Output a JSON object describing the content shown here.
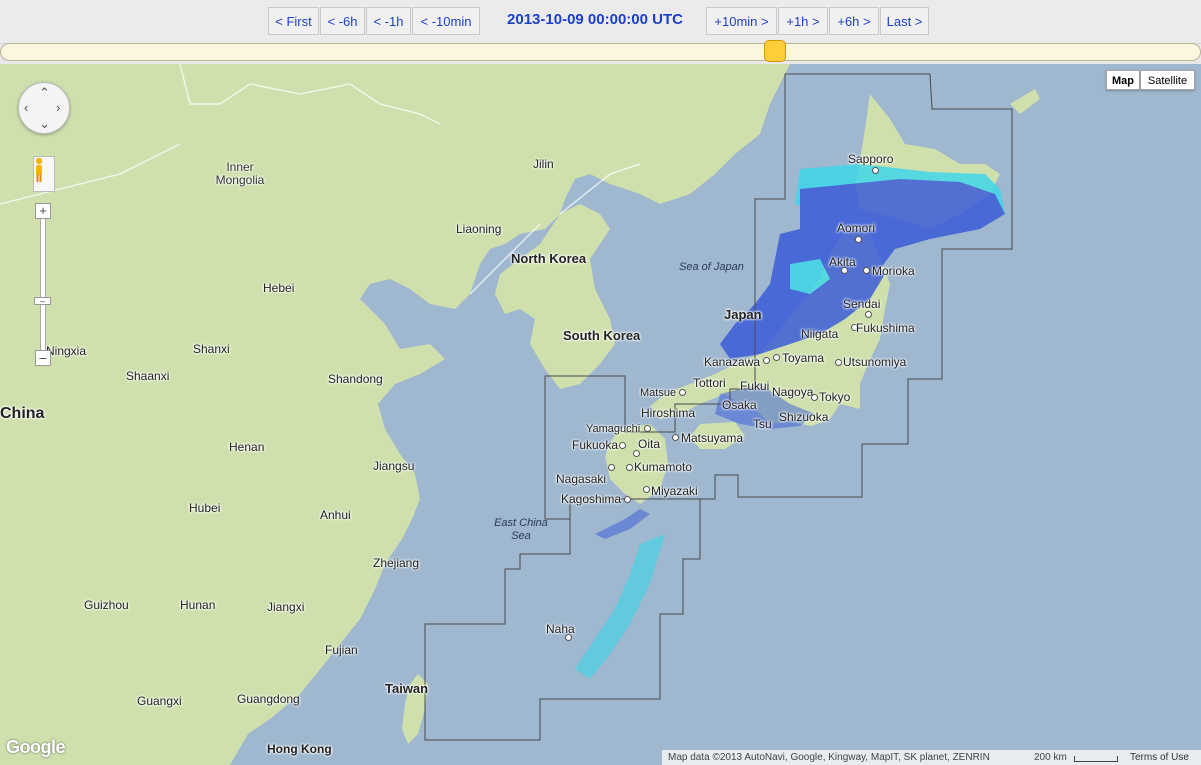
{
  "nav": {
    "first": "< First",
    "minus6h": "< -6h",
    "minus1h": "< -1h",
    "minus10min": "< -10min",
    "timestamp": "2013-10-09 00:00:00 UTC",
    "plus10min": "+10min >",
    "plus1h": "+1h >",
    "plus6h": "+6h >",
    "last": "Last >"
  },
  "map_type": {
    "map": "Map",
    "satellite": "Satellite",
    "selected": "Map"
  },
  "labels": {
    "inner_mongolia": "Inner Mongolia",
    "jilin": "Jilin",
    "liaoning": "Liaoning",
    "north_korea": "North Korea",
    "south_korea": "South Korea",
    "sea_of_japan": "Sea of Japan",
    "japan": "Japan",
    "hebei": "Hebei",
    "ningxia": "Ningxia",
    "shanxi": "Shanxi",
    "shaanxi": "Shaanxi",
    "shandong": "Shandong",
    "china": "China",
    "henan": "Henan",
    "jiangsu": "Jiangsu",
    "hubei": "Hubei",
    "anhui": "Anhui",
    "east_china_sea": "East China Sea",
    "zhejiang": "Zhejiang",
    "guizhou": "Guizhou",
    "hunan": "Hunan",
    "jiangxi": "Jiangxi",
    "fujian": "Fujian",
    "guangxi": "Guangxi",
    "guangdong": "Guangdong",
    "taiwan": "Taiwan",
    "hong_kong": "Hong Kong"
  },
  "cities": {
    "sapporo": "Sapporo",
    "aomori": "Aomori",
    "akita": "Akita",
    "morioka": "Morioka",
    "sendai": "Sendai",
    "niigata": "Niigata",
    "fukushima": "Fukushima",
    "kanazawa": "Kanazawa",
    "toyama": "Toyama",
    "utsunomiya": "Utsunomiya",
    "matsue": "Matsue",
    "tottori": "Tottori",
    "fukui": "Fukui",
    "nagoya": "Nagoya",
    "tokyo": "Tokyo",
    "hiroshima": "Hiroshima",
    "osaka": "Osaka",
    "shizuoka": "Shizuoka",
    "yamaguchi": "Yamaguchi",
    "tsu": "Tsu",
    "matsuyama": "Matsuyama",
    "fukuoka": "Fukuoka",
    "oita": "Oita",
    "nagasaki": "Nagasaki",
    "kumamoto": "Kumamoto",
    "miyazaki": "Miyazaki",
    "kagoshima": "Kagoshima",
    "naha": "Naha"
  },
  "attribution": {
    "data": "Map data ©2013 AutoNavi, Google, Kingway, MapIT, SK planet, ZENRIN",
    "scale": "200 km",
    "terms": "Terms of Use"
  },
  "logo": "Google",
  "colors": {
    "land": "#cfe0ad",
    "water": "#9fb7cf",
    "radar_light": "#3fd6e8",
    "radar_dark": "#3a5cd8",
    "nav_text": "#1b3fc9",
    "slider_handle": "#ffcc3a"
  }
}
